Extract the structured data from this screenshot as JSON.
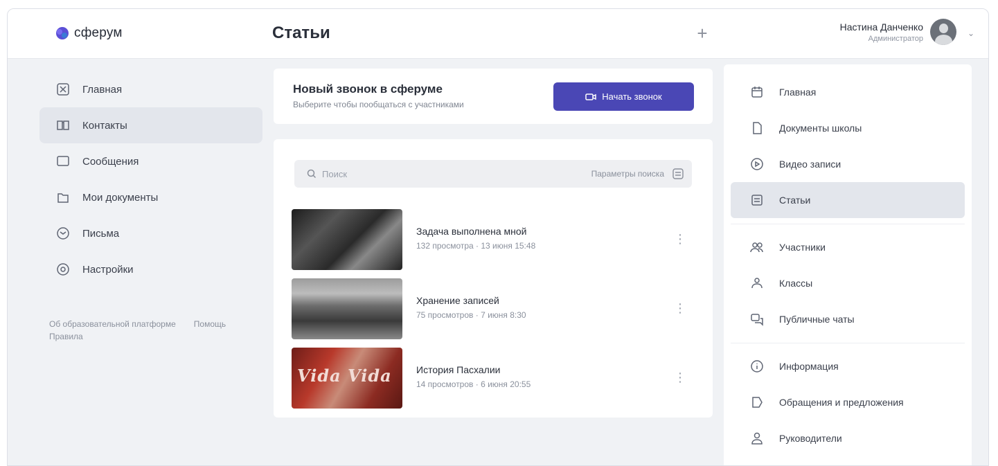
{
  "header": {
    "logo_text": "сферум",
    "page_title": "Статьи",
    "add_label": "+",
    "user_name": "Настина Данченко",
    "user_status": "Администратор",
    "menu_chevron": "⌄"
  },
  "left_nav": {
    "items": [
      {
        "label": "Главная",
        "icon": "grid-icon"
      },
      {
        "label": "Контакты",
        "icon": "book-icon"
      },
      {
        "label": "Сообщения",
        "icon": "chat-icon"
      },
      {
        "label": "Мои документы",
        "icon": "folder-icon"
      },
      {
        "label": "Письма",
        "icon": "mail-icon"
      },
      {
        "label": "Настройки",
        "icon": "gear-icon"
      }
    ],
    "active_index": 1,
    "footer_left": "Об образовательной платформе",
    "footer_right": "Помощь",
    "footer_line2": "Правила"
  },
  "call_card": {
    "title": "Новый звонок в сферуме",
    "subtitle": "Выберите чтобы пообщаться с участниками",
    "button_label": "Начать звонок"
  },
  "list": {
    "search_placeholder": "Поиск",
    "params_label": "Параметры поиска",
    "items": [
      {
        "title": "Задача выполнена мной",
        "meta": "132 просмотра · 13 июня 15:48",
        "more": "⋮"
      },
      {
        "title": "Хранение записей",
        "meta": "75 просмотров · 7 июня 8:30",
        "more": "⋮"
      },
      {
        "title": "История Пасхалии",
        "meta": "14 просмотров · 6 июня 20:55",
        "more": "⋮"
      }
    ],
    "thumb_overlay": "Vida Vida"
  },
  "right_panel": {
    "items": [
      {
        "label": "Главная",
        "icon": "calendar-icon"
      },
      {
        "label": "Документы школы",
        "icon": "document-icon"
      },
      {
        "label": "Видео записи",
        "icon": "video-icon"
      },
      {
        "label": "Статьи",
        "icon": "article-icon"
      },
      {
        "label": "Участники",
        "icon": "users-icon"
      },
      {
        "label": "Классы",
        "icon": "classes-icon"
      },
      {
        "label": "Публичные чаты",
        "icon": "chats-icon"
      },
      {
        "label": "Информация",
        "icon": "info-icon"
      },
      {
        "label": "Обращения и предложения",
        "icon": "feedback-icon"
      },
      {
        "label": "Руководители",
        "icon": "person-icon"
      }
    ],
    "active_index": 3
  },
  "colors": {
    "accent": "#4a47b5",
    "active_bg": "#e3e6ec",
    "page_bg": "#f0f2f5"
  }
}
